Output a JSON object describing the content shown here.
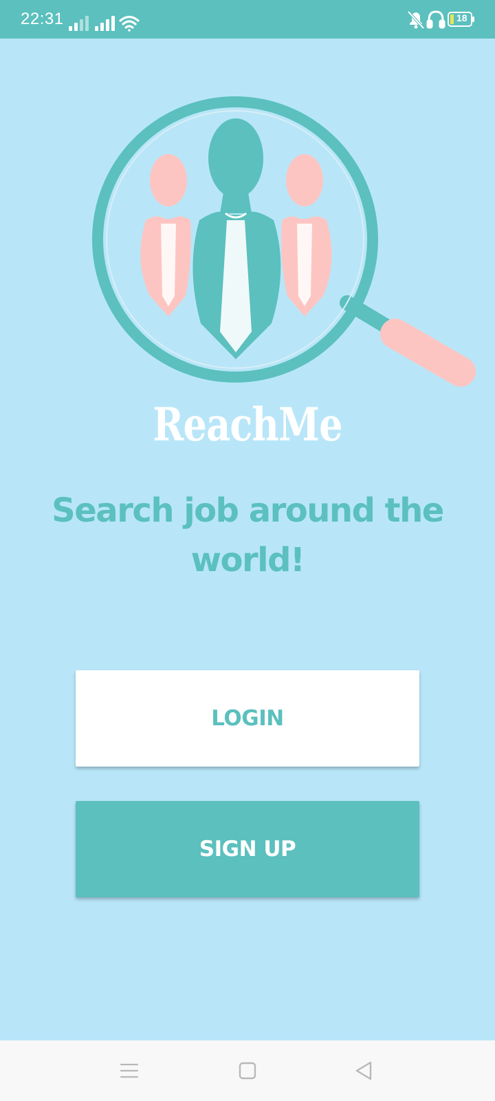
{
  "status_bar": {
    "time": "22:31",
    "battery": "18",
    "background": "#5bc0be",
    "icons": [
      "signal-icon",
      "signal-icon",
      "wifi-icon",
      "bell-muted-icon",
      "headphones-icon",
      "battery-icon"
    ]
  },
  "brand": {
    "name": "ReachMe",
    "logo_icon": "magnifier-people-logo",
    "colors": {
      "teal": "#5bc0be",
      "pink": "#fdc5c2",
      "background": "#b8e6f8"
    }
  },
  "tagline": "Search job around the world!",
  "buttons": {
    "login": "LOGIN",
    "signup": "SIGN UP"
  },
  "nav_bar": {
    "icons": [
      "menu-icon",
      "home-square-icon",
      "back-triangle-icon"
    ]
  }
}
